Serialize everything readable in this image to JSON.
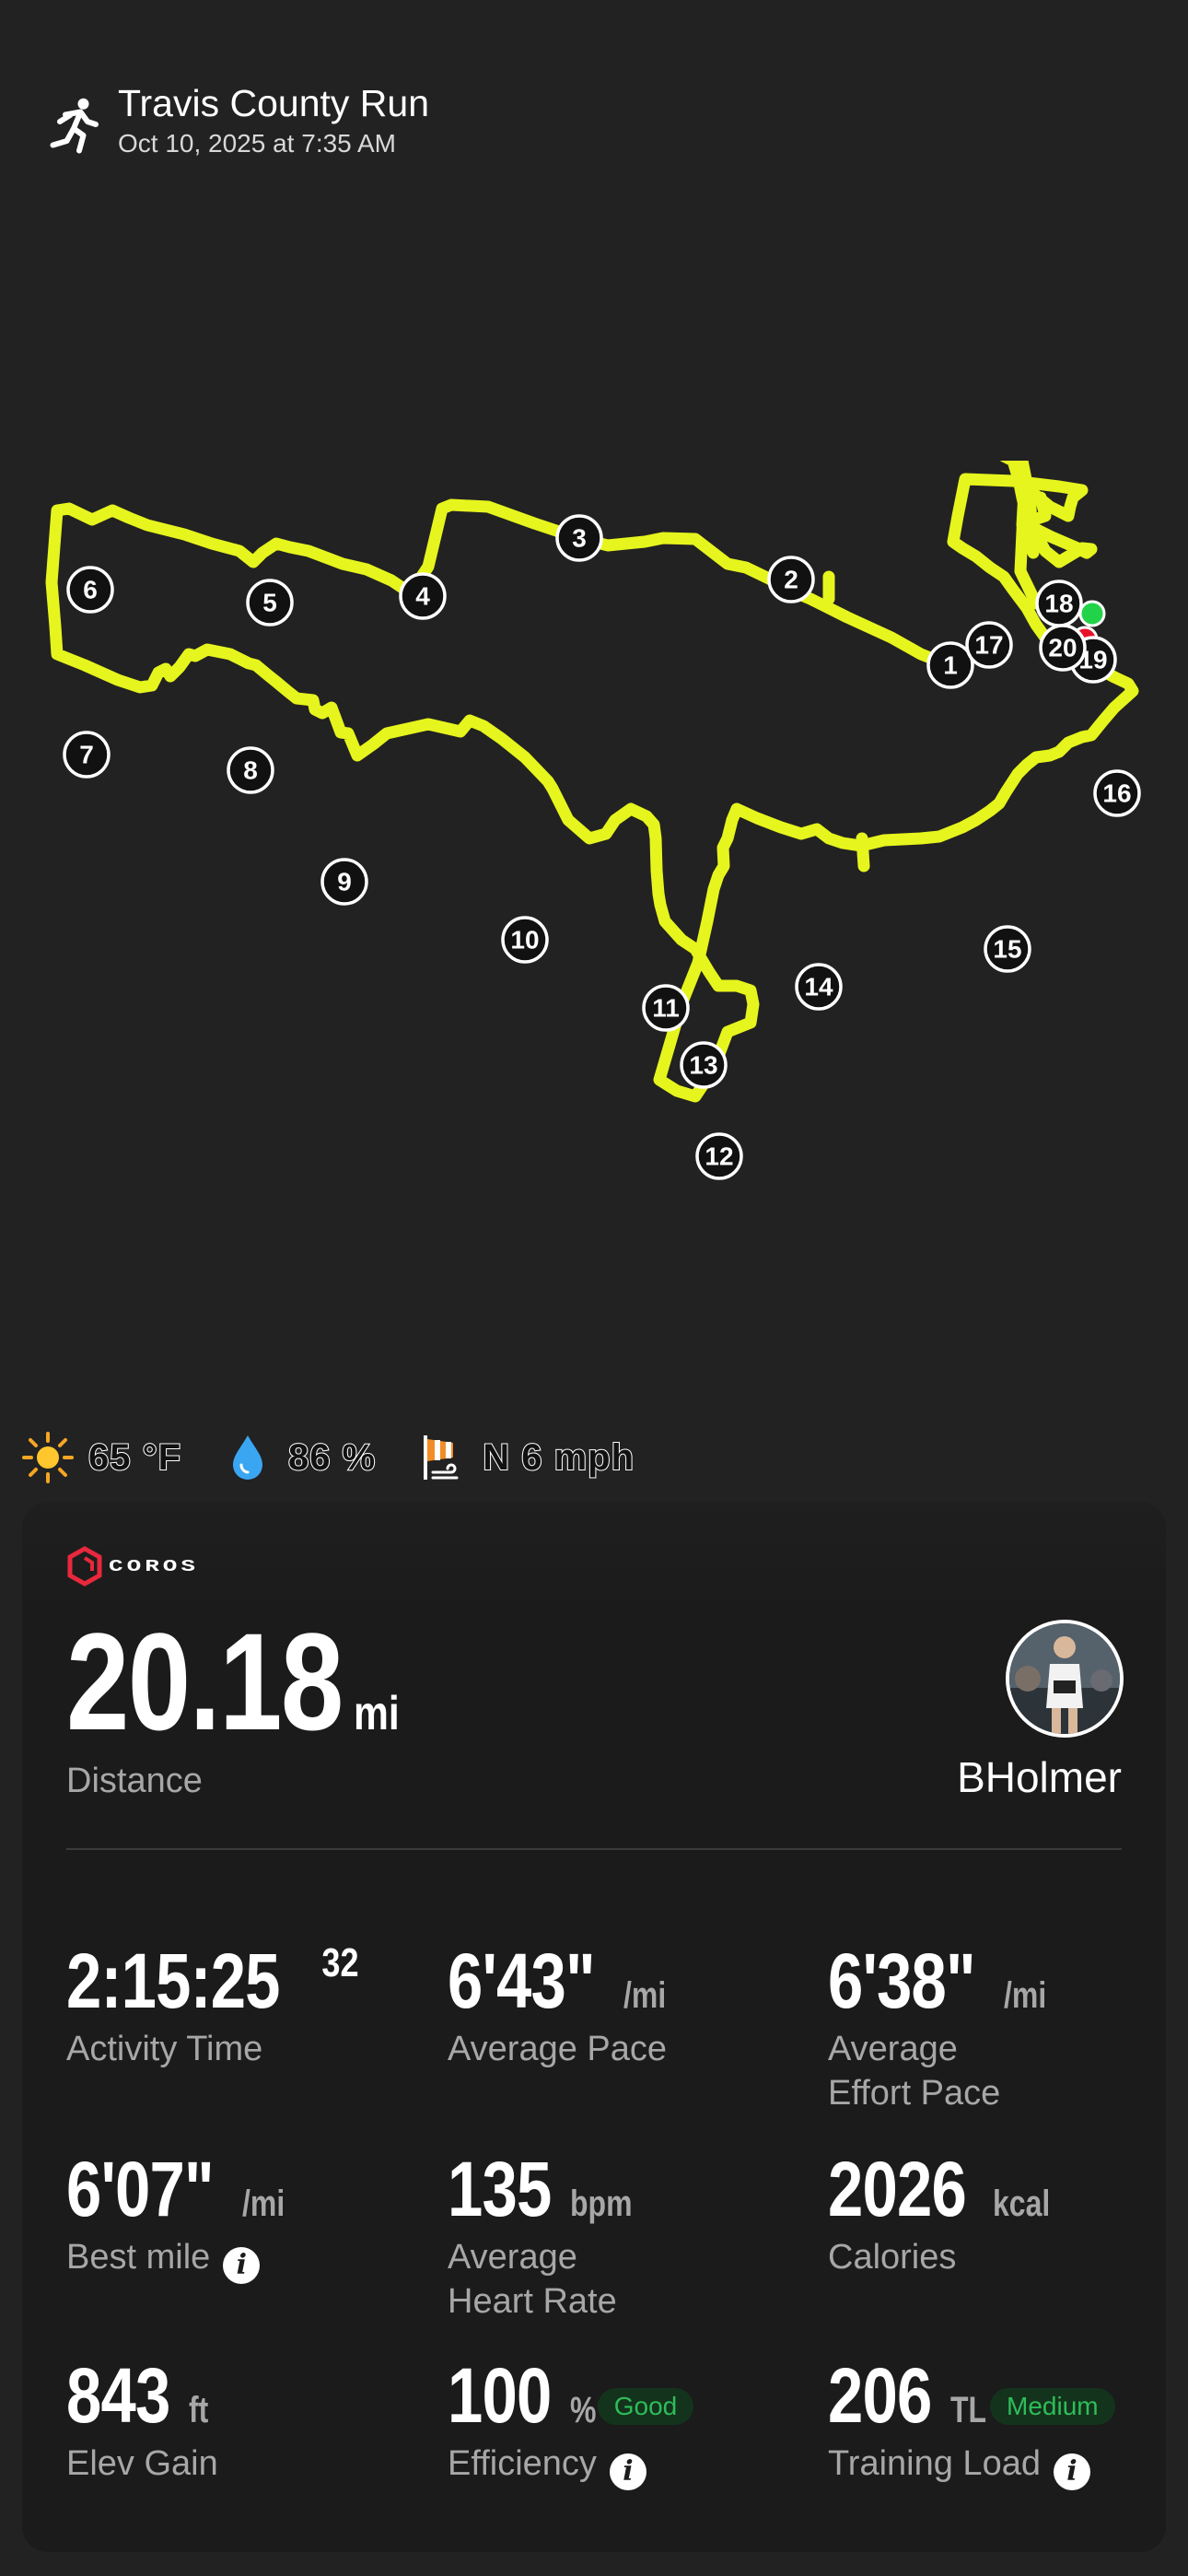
{
  "activity": {
    "icon": "running-person-icon",
    "title": "Travis County Run",
    "datetime": "Oct 10, 2025 at 7:35 AM"
  },
  "map": {
    "route_color": "#e6f51d",
    "start_color": "#22d34a",
    "end_color": "#e8102a",
    "mile_markers": [
      "1",
      "2",
      "3",
      "4",
      "5",
      "6",
      "7",
      "8",
      "9",
      "10",
      "11",
      "12",
      "13",
      "14",
      "15",
      "16",
      "17",
      "18",
      "19",
      "20"
    ]
  },
  "weather": {
    "temperature": "65 °F",
    "humidity": "86 %",
    "wind": "N 6 mph",
    "icons": [
      "sun-icon",
      "water-drop-icon",
      "wind-flag-icon"
    ]
  },
  "card": {
    "brand": "COROS",
    "brand_color": "#e8283c",
    "distance": {
      "value": "20.18",
      "unit": "mi",
      "label": "Distance"
    },
    "user": {
      "name": "BHolmer"
    },
    "metrics": [
      {
        "value": "2:15:25",
        "sup": "32",
        "unit": "",
        "label": "Activity Time"
      },
      {
        "value": "6'43\"",
        "unit": "/mi",
        "label": "Average Pace"
      },
      {
        "value": "6'38\"",
        "unit": "/mi",
        "label": "Average\nEffort Pace"
      },
      {
        "value": "6'07\"",
        "unit": "/mi",
        "label": "Best mile"
      },
      {
        "value": "135",
        "unit": "bpm",
        "label": "Average\nHeart Rate"
      },
      {
        "value": "2026",
        "unit": "kcal",
        "label": "Calories"
      },
      {
        "value": "843",
        "unit": "ft",
        "label": "Elev Gain"
      },
      {
        "value": "100",
        "unit": "%",
        "label": "Efficiency",
        "badge": "Good"
      },
      {
        "value": "206",
        "unit": "TL",
        "label": "Training Load",
        "badge": "Medium"
      }
    ]
  }
}
